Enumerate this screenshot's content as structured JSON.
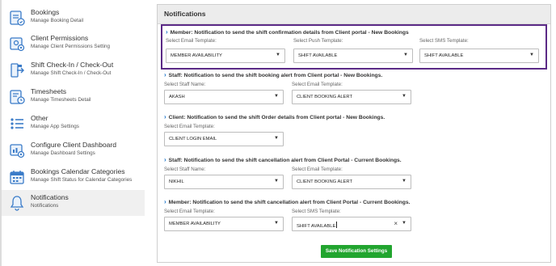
{
  "sidebar": {
    "items": [
      {
        "title": "Bookings",
        "subtitle": "Manage Booking Detail",
        "icon": "bookings-icon"
      },
      {
        "title": "Client Permissions",
        "subtitle": "Manage Client Permissions Setting",
        "icon": "permissions-icon"
      },
      {
        "title": "Shift Check-In / Check-Out",
        "subtitle": "Manage Shift Check-In / Check-Out",
        "icon": "check-in-icon"
      },
      {
        "title": "Timesheets",
        "subtitle": "Manage Timesheets Detail",
        "icon": "timesheet-icon"
      },
      {
        "title": "Other",
        "subtitle": "Manage App Settings",
        "icon": "list-icon"
      },
      {
        "title": "Configure Client Dashboard",
        "subtitle": "Manage Dashboard Settings",
        "icon": "dashboard-icon"
      },
      {
        "title": "Bookings Calendar Categories",
        "subtitle": "Manage Shift Status for Calendar Categories",
        "icon": "calendar-icon"
      },
      {
        "title": "Notifications",
        "subtitle": "Notifications",
        "icon": "bell-icon",
        "active": true
      }
    ]
  },
  "panel": {
    "title": "Notifications"
  },
  "sections": [
    {
      "title": "Member: Notification to send the shift confirmation details from Client portal - New Bookings",
      "fields": [
        {
          "label": "Select Email Template:",
          "value": "MEMBER AVAILABILITY"
        },
        {
          "label": "Select Push Template:",
          "value": "SHIFT AVAILABLE"
        },
        {
          "label": "Select SMS Template:",
          "value": "SHIFT AVAILABLE"
        }
      ]
    },
    {
      "title": "Staff: Notification to send the shift booking alert from Client portal - New Bookings.",
      "fields": [
        {
          "label": "Select Staff Name:",
          "value": "AKASH"
        },
        {
          "label": "Select Email Template:",
          "value": "CLIENT BOOKING ALERT"
        }
      ]
    },
    {
      "title": "Client: Notification to send the shift Order details from Client portal - New Bookings.",
      "fields": [
        {
          "label": "Select Email Template:",
          "value": "CLIENT LOGIN EMAIL"
        }
      ]
    },
    {
      "title": "Staff: Notification to send the shift cancellation alert from Client Portal - Current Bookings.",
      "fields": [
        {
          "label": "Select Staff Name:",
          "value": "NIKHIL"
        },
        {
          "label": "Select Email Template:",
          "value": "CLIENT BOOKING ALERT"
        }
      ]
    },
    {
      "title": "Member: Notification to send the shift cancellation alert from Client Portal - Current Bookings.",
      "fields": [
        {
          "label": "Select Email Template:",
          "value": "MEMBER AVAILABILITY"
        },
        {
          "label": "Select SMS Template:",
          "value": "SHIFT AVAILABLE"
        }
      ]
    }
  ],
  "save_button": "Save Notification Settings",
  "colors": {
    "highlight": "#5b2a86",
    "save": "#22a52f",
    "icon": "#3a7bc8",
    "chevron": "#1a73c9"
  }
}
